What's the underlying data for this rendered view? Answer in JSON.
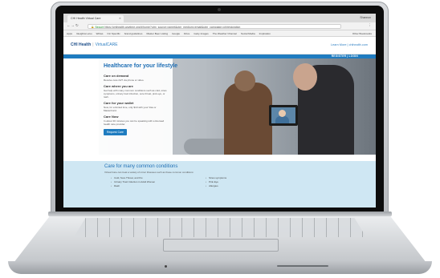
{
  "browser": {
    "tab_title": "CHI Health Virtual Care",
    "window_user": "Shannon",
    "url_secure": "Secure",
    "url_rest": "https://chihealth.anytime.org/#/home?utm_source=ramet&utm_medium=email&utm_campaign=chirestoration",
    "bookmarks": [
      "Apps",
      "Gleighton.wsu",
      "Writas",
      "CIc Specific",
      "brand guidelines",
      "Master Beer Listing",
      "Google",
      "Drive",
      "Getty Images",
      "The Weather Channel",
      "Social Media",
      "Inspiration"
    ],
    "bookmark_other": "Other Bookmarks"
  },
  "site": {
    "logo_brand": "CHI Health",
    "logo_product": "VirtualCARE",
    "learn_more": "Learn More",
    "domain_link": "chihealth.com",
    "register": "REGISTER",
    "login": "LOGIN"
  },
  "hero": {
    "title": "Healthcare for your lifestyle",
    "sections": [
      {
        "heading": "Care on demand",
        "body": "Receive care 24/7 via phone or video."
      },
      {
        "heading": "Care where you are",
        "body": "Get help with many common conditions such as cold, sinus symptoms, urinary tract infection, sore throat, pink eye, or rash."
      },
      {
        "heading": "Care for your wallet",
        "body": "Now, for a limited time, only $10 with your Visa or MasterCard."
      },
      {
        "heading": "Care Now",
        "body": "In about 30 minutes you can be speaking with a licensed health care provider."
      }
    ],
    "button_label": "Request Care"
  },
  "conditions": {
    "title": "Care for many common conditions",
    "intro": "Virtual Care can treat a variety of minor illnesses such as these common conditions:",
    "col1": [
      "Cold, Sore Throat, and Flu",
      "Urinary Tract Infection in Adult Women",
      "Rash"
    ],
    "col2": [
      "Sinus symptoms",
      "Pink Eye",
      "Allergies"
    ]
  }
}
